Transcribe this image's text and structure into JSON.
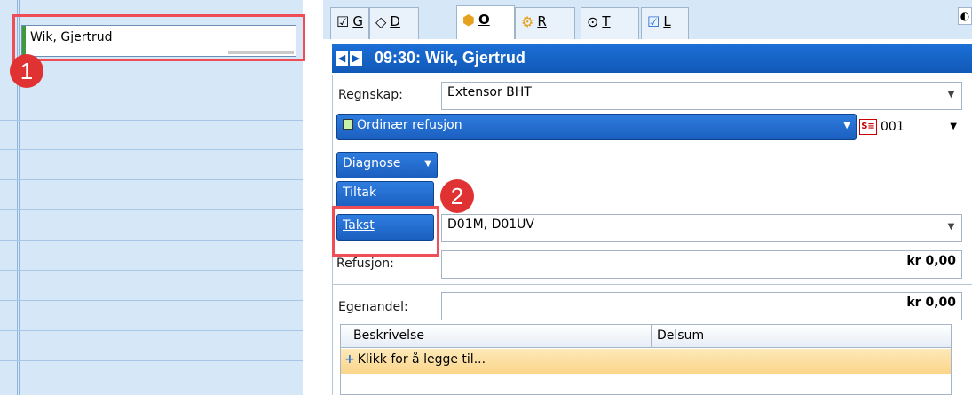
{
  "appointment": {
    "name": "Wik, Gjertrud"
  },
  "annotations": {
    "marker1": "1",
    "marker2": "2"
  },
  "tabs": [
    {
      "icon": "checklist-icon",
      "key": "G"
    },
    {
      "icon": "diamond-icon",
      "key": "D"
    },
    {
      "icon": "billing-icon",
      "key": "O"
    },
    {
      "icon": "prescription-icon",
      "key": "R"
    },
    {
      "icon": "clock-icon",
      "key": "T"
    },
    {
      "icon": "list-check-icon",
      "key": "L"
    }
  ],
  "header": {
    "title": "09:30: Wik, Gjertrud"
  },
  "form": {
    "regnskap_label": "Regnskap:",
    "regnskap_value": "Extensor BHT",
    "refusjon_type": "Ordinær refusjon",
    "code_value": "001",
    "diagnose_label": "Diagnose",
    "tiltak_label": "Tiltak",
    "takst_label": "Takst",
    "takst_value": "D01M, D01UV",
    "refusjon_label": "Refusjon:",
    "refusjon_value": "kr 0,00",
    "egenandel_label": "Egenandel:",
    "egenandel_value": "kr 0,00"
  },
  "grid": {
    "columns": [
      "Beskrivelse",
      "Delsum"
    ],
    "add_row": "Klikk for å legge til..."
  },
  "colors": {
    "header_blue": "#1159b8",
    "calendar_bg": "#d6e8f8",
    "highlight_red": "#ef4e56",
    "add_row_orange": "#fbd58a"
  }
}
